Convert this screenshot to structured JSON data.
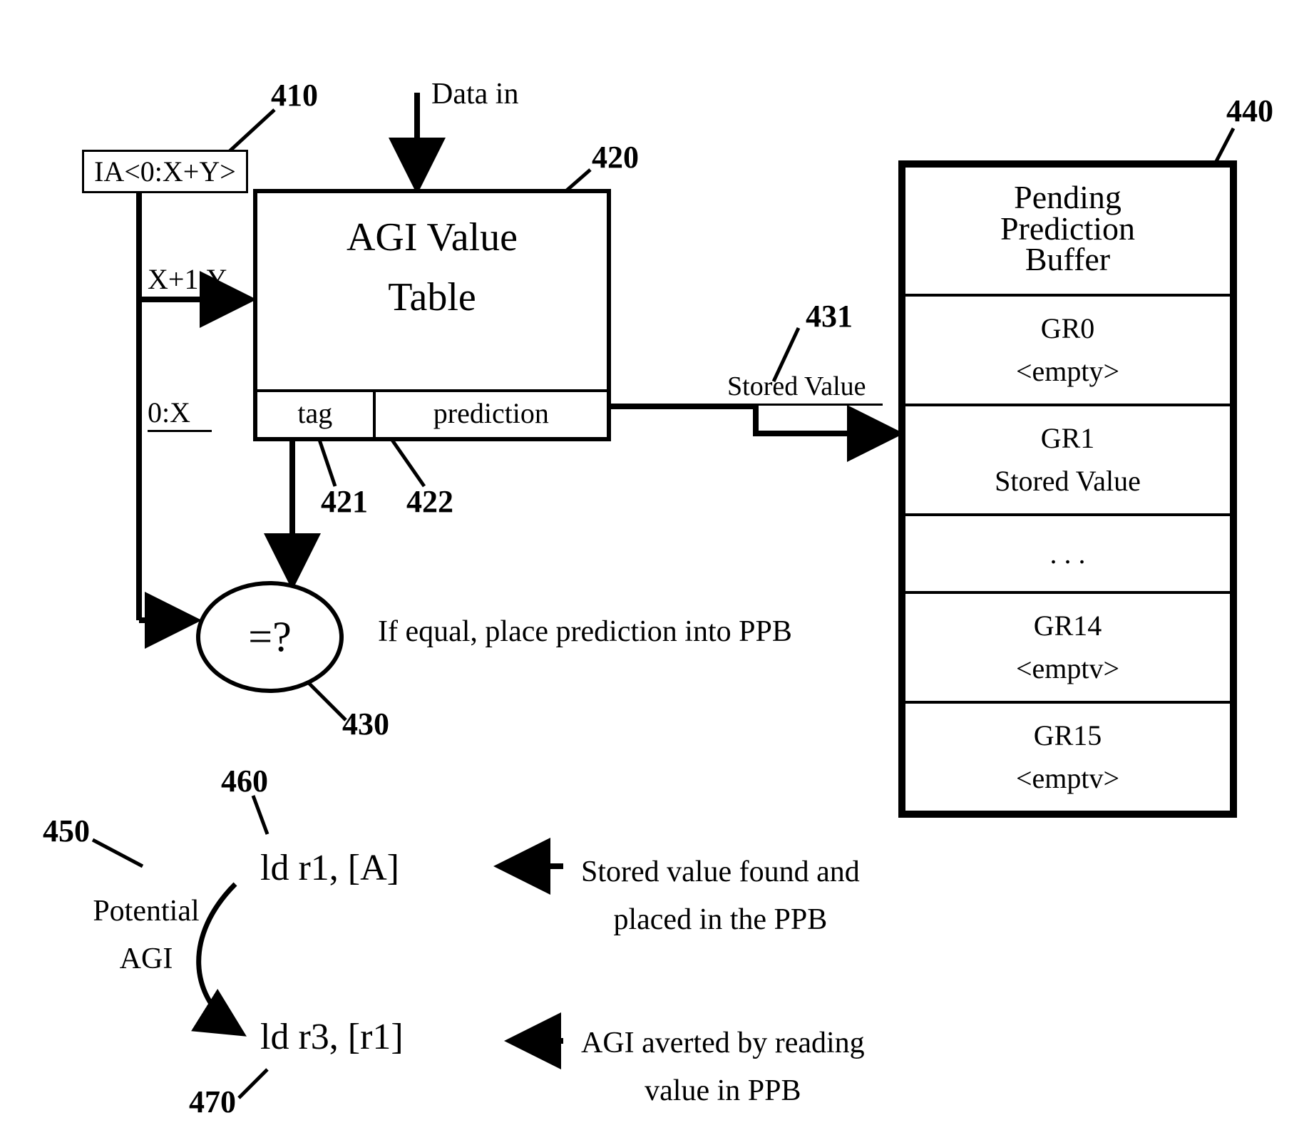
{
  "labels": {
    "n410": "410",
    "n420": "420",
    "n421": "421",
    "n422": "422",
    "n430": "430",
    "n431": "431",
    "n440": "440",
    "n450": "450",
    "n460": "460",
    "n470": "470"
  },
  "ia_box": "IA<0:X+Y>",
  "data_in": "Data in",
  "agi_table_title_l1": "AGI Value",
  "agi_table_title_l2": "Table",
  "agi_tag": "tag",
  "agi_pred": "prediction",
  "wire_x1y": "X+1:Y",
  "wire_0x": "0:X",
  "stored_value_wire": "Stored Value",
  "cmp_symbol": "=?",
  "cmp_text": "If equal, place prediction into PPB",
  "ppb_header_l1": "Pending",
  "ppb_header_l2": "Prediction",
  "ppb_header_l3": "Buffer",
  "ppb": {
    "r0": {
      "name": "GR0",
      "state": "<empty>"
    },
    "r1": {
      "name": "GR1",
      "state": "Stored Value"
    },
    "dots": ". . .",
    "r14": {
      "name": "GR14",
      "state": "<emptv>"
    },
    "r15": {
      "name": "GR15",
      "state": "<emptv>"
    }
  },
  "instr1": "ld r1, [A]",
  "instr2": "ld r3, [r1]",
  "instr1_note_l1": "Stored value found and",
  "instr1_note_l2": "placed in the PPB",
  "instr2_note_l1": "AGI averted by reading",
  "instr2_note_l2": "value in PPB",
  "potential_agi_l1": "Potential",
  "potential_agi_l2": "AGI"
}
